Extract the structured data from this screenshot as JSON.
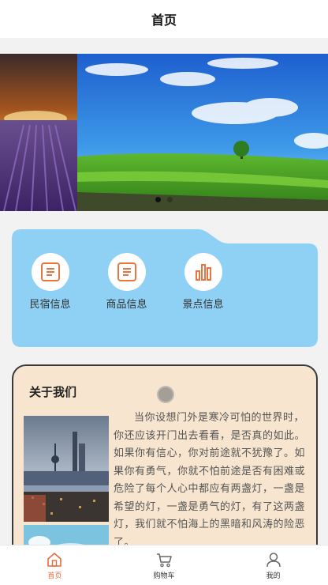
{
  "header": {
    "title": "首页"
  },
  "banner": {
    "slide_count": 2,
    "active_slide": 1
  },
  "menu": {
    "items": [
      {
        "label": "民宿信息",
        "icon": "document-icon"
      },
      {
        "label": "商品信息",
        "icon": "document-icon"
      },
      {
        "label": "景点信息",
        "icon": "bar-chart-icon"
      }
    ],
    "accent_color": "#e8743f",
    "card_color": "#8fd0f5"
  },
  "about": {
    "title": "关于我们",
    "text": "当你设想门外是寒冷可怕的世界时，你还应该开门出去看看，是否真的如此。如果你有信心，你对前途就不犹豫了。如果你有勇气，你就不怕前途是否有困难或危险了每个人心中都应有两盏灯，一盏是希望的灯，一盏是勇气的灯，有了这两盏灯，我们就不怕海上的黑暗和风涛的险恶了。"
  },
  "tabbar": {
    "tabs": [
      {
        "label": "首页",
        "icon": "home-icon",
        "active": true
      },
      {
        "label": "购物车",
        "icon": "cart-icon",
        "active": false
      },
      {
        "label": "我的",
        "icon": "user-icon",
        "active": false
      }
    ],
    "active_color": "#e26b3d"
  }
}
